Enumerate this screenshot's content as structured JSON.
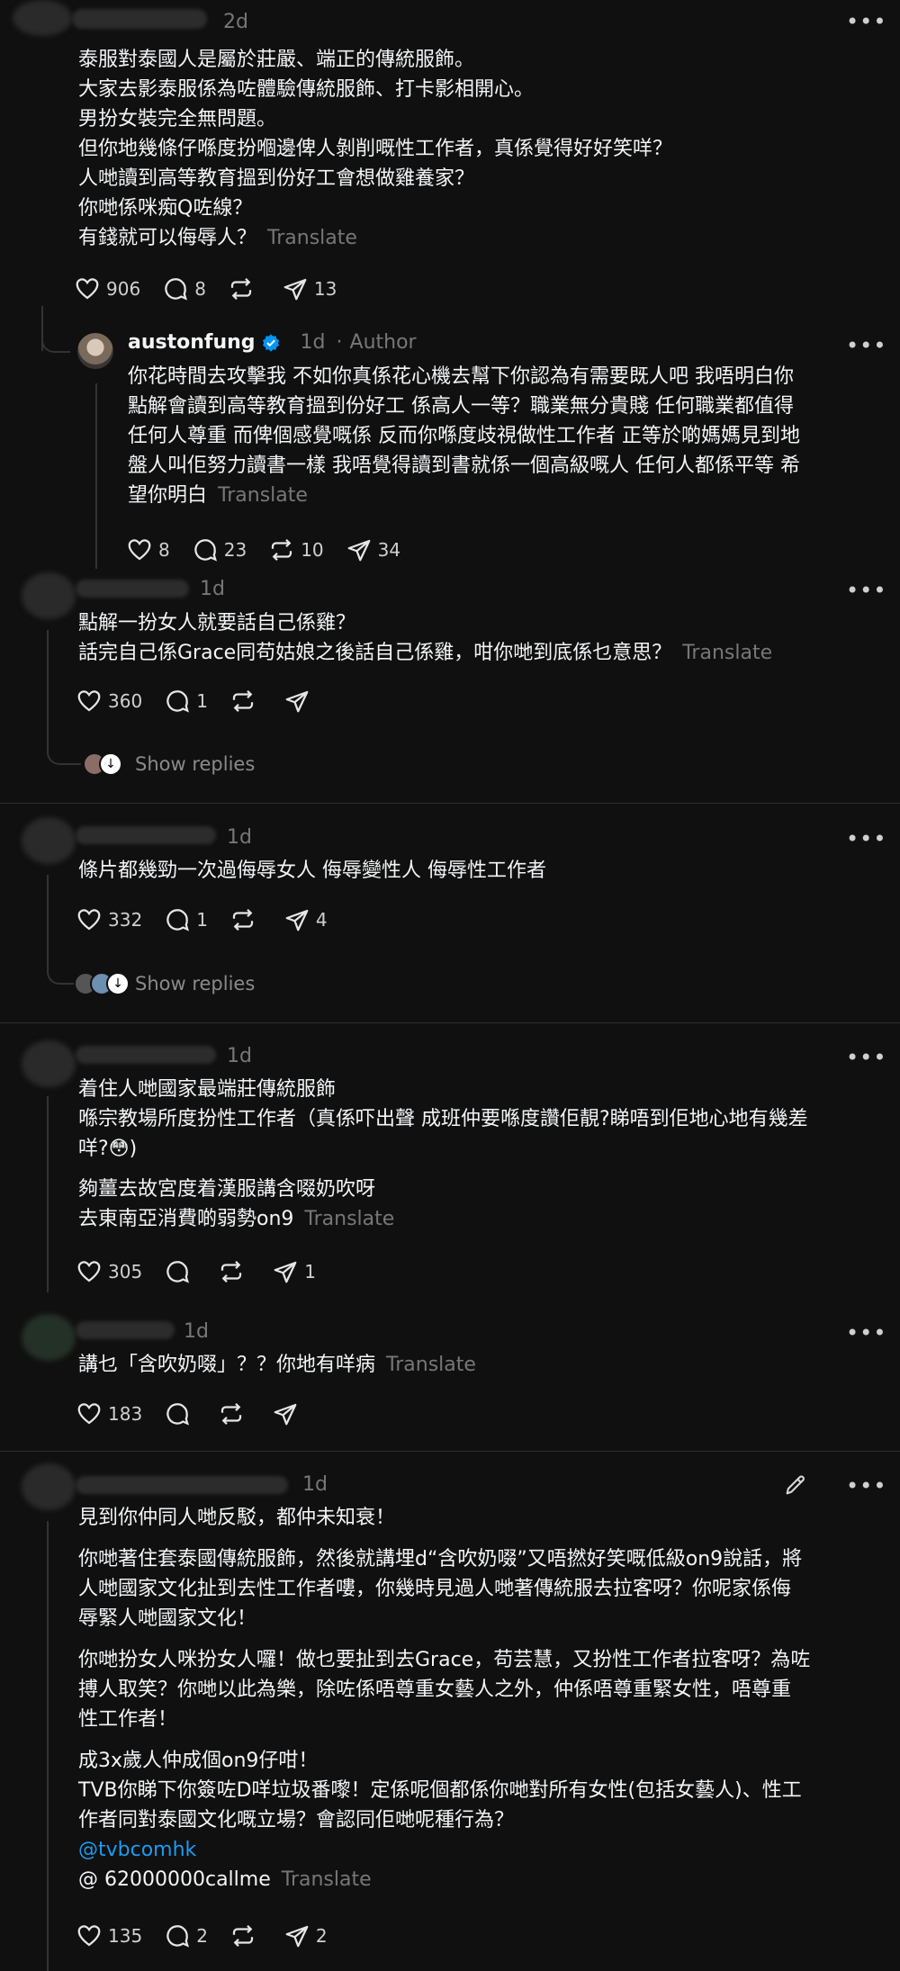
{
  "comments": [
    {
      "id": "c1",
      "time": "2d",
      "lines": [
        "泰服對泰國人是屬於莊嚴、端正的傳統服飾。",
        "大家去影泰服係為咗體驗傳統服飾、打卡影相開心。",
        "男扮女裝完全無問題。",
        "但你地幾條仔喺度扮嗰邊俾人剝削嘅性工作者，真係覺得好好笑咩？",
        "人哋讀到高等教育搵到份好工會想做雞養家？",
        "你哋係咪痴Q咗線？",
        "有錢就可以侮辱人？"
      ],
      "translate": "Translate",
      "likes": "906",
      "replies": "8",
      "reposts": "",
      "shares": "13"
    },
    {
      "id": "author-reply",
      "username": "austonfung",
      "verified": true,
      "time": "1d",
      "author_tag": "Author",
      "lines": [
        "你花時間去攻擊我 不如你真係花心機去幫下你認為有需要既人吧 我唔明白你",
        "點解會讀到高等教育搵到份好工 係高人一等？職業無分貴賤 任何職業都值得",
        "任何人尊重 而俾個感覺嘅係 反而你喺度歧視做性工作者 正等於啲媽媽見到地",
        "盤人叫佢努力讀書一樣 我唔覺得讀到書就係一個高級嘅人 任何人都係平等 希",
        "望你明白"
      ],
      "translate": "Translate",
      "likes": "8",
      "replies": "23",
      "reposts": "10",
      "shares": "34"
    },
    {
      "id": "c2",
      "time": "1d",
      "lines": [
        "點解一扮女人就要話自己係雞？",
        "話完自己係Grace同苟姑娘之後話自己係雞，咁你哋到底係乜意思？"
      ],
      "translate": "Translate",
      "likes": "360",
      "replies": "1",
      "reposts": "",
      "shares": "",
      "show_replies": "Show replies"
    },
    {
      "id": "c3",
      "time": "1d",
      "lines": [
        "條片都幾勁一次過侮辱女人 侮辱變性人 侮辱性工作者"
      ],
      "likes": "332",
      "replies": "1",
      "reposts": "",
      "shares": "4",
      "show_replies": "Show replies"
    },
    {
      "id": "c4",
      "time": "1d",
      "lines": [
        "着住人哋國家最端莊傳統服飾",
        "喺宗教場所度扮性工作者（真係吓出聲 成班仲要喺度讚佢靚?睇唔到佢地心地有幾差",
        "咩?😳)"
      ],
      "lines2": [
        "夠薑去故宮度着漢服講含啜奶吹呀",
        "去東南亞消費啲弱勢on9"
      ],
      "translate": "Translate",
      "likes": "305",
      "replies": "",
      "reposts": "",
      "shares": "1"
    },
    {
      "id": "c5",
      "time": "1d",
      "lines": [
        "講乜「含吹奶啜」？？你地有咩病"
      ],
      "translate": "Translate",
      "likes": "183",
      "replies": "",
      "reposts": "",
      "shares": ""
    },
    {
      "id": "c6",
      "time": "1d",
      "p1": "見到你仲同人哋反駁，都仲未知衰！",
      "p2": [
        "你哋著住套泰國傳統服飾，然後就講埋d“含吹奶啜”又唔撚好笑嘅低級on9說話，將",
        "人哋國家文化扯到去性工作者嘍，你幾時見過人哋著傳統服去拉客呀？你呢家係侮",
        "辱緊人哋國家文化！"
      ],
      "p3": [
        "你哋扮女人咪扮女人囉！做乜要扯到去Grace，苟芸慧，又扮性工作者拉客呀？為咗",
        "搏人取笑？你哋以此為樂，除咗係唔尊重女藝人之外，仲係唔尊重緊女性，唔尊重",
        "性工作者！"
      ],
      "p4": [
        "成3x歲人仲成個on9仔咁！",
        "TVB你睇下你簽咗D咩垃圾番嚟！定係呢個都係你哋對所有女性(包括女藝人)、性工",
        "作者同對泰國文化嘅立場？會認同佢哋呢種行為？"
      ],
      "mention1": "@tvbcomhk",
      "mention2": "@ 62000000callme",
      "translate": "Translate",
      "likes": "135",
      "replies": "2",
      "reposts": "",
      "shares": "2"
    }
  ],
  "icons": [
    "heart-icon",
    "comment-icon",
    "repost-icon",
    "share-icon",
    "more-icon",
    "verified-icon",
    "edit-icon"
  ],
  "colors": {
    "background": "#101010",
    "text": "#f3f5f7",
    "muted": "#777777",
    "link": "#1d9bf0",
    "verified": "#0095f6"
  }
}
